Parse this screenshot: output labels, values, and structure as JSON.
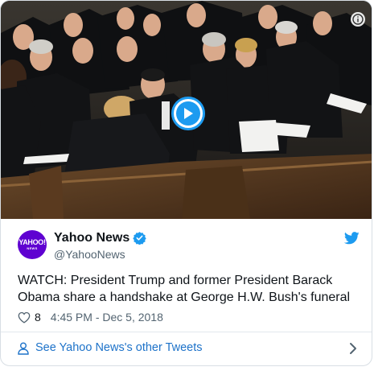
{
  "media": {
    "alt": "",
    "colors": {
      "play_ring": "#1d9bf0",
      "play_fill": "#1d9bf0"
    }
  },
  "author": {
    "avatar_text_line1": "YAHOO!",
    "avatar_text_line2": "NEWS",
    "display_name": "Yahoo News",
    "handle": "@YahooNews",
    "verified": true,
    "avatar_color": "#5f01d1"
  },
  "tweet": {
    "text": "WATCH: President Trump and former President Barack Obama share a handshake at George H.W. Bush's funeral",
    "likes": "8",
    "timestamp": "4:45 PM - Dec 5, 2018"
  },
  "footer": {
    "link_text": "See Yahoo News's other Tweets"
  },
  "icons": {
    "info": "info-icon",
    "play": "play-icon",
    "verified": "verified-badge-icon",
    "twitter": "twitter-bird-icon",
    "heart": "heart-icon",
    "user": "user-icon",
    "chevron": "chevron-right-icon"
  },
  "colors": {
    "link": "#1d72c9",
    "twitter_blue": "#1d9bf0",
    "text": "#0f1419",
    "muted": "#536471"
  }
}
